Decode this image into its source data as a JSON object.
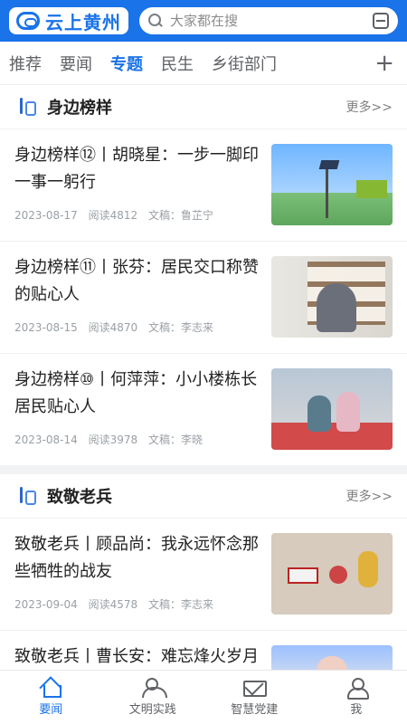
{
  "header": {
    "logo_text": "云上黄州",
    "search_placeholder": "大家都在搜"
  },
  "tabs": [
    {
      "label": "推荐"
    },
    {
      "label": "要闻"
    },
    {
      "label": "专题"
    },
    {
      "label": "民生"
    },
    {
      "label": "乡街部门"
    }
  ],
  "tabs_plus": "+",
  "sections": [
    {
      "title": "身边榜样",
      "more": "更多>>",
      "items": [
        {
          "title": "身边榜样⑫丨胡晓星：一步一脚印 一事一躬行",
          "date": "2023-08-17",
          "reads": "阅读4812",
          "author": "文稿：鲁芷宁"
        },
        {
          "title": "身边榜样⑪丨张芬：居民交口称赞的贴心人",
          "date": "2023-08-15",
          "reads": "阅读4870",
          "author": "文稿：李志来"
        },
        {
          "title": "身边榜样⑩丨何萍萍：小小楼栋长 居民贴心人",
          "date": "2023-08-14",
          "reads": "阅读3978",
          "author": "文稿：李晓"
        }
      ]
    },
    {
      "title": "致敬老兵",
      "more": "更多>>",
      "items": [
        {
          "title": "致敬老兵丨顾品尚：我永远怀念那些牺牲的战友",
          "date": "2023-09-04",
          "reads": "阅读4578",
          "author": "文稿：李志来"
        },
        {
          "title": "致敬老兵丨曹长安：难忘烽火岁月 永葆革命本色",
          "date": "",
          "reads": "",
          "author": ""
        }
      ]
    }
  ],
  "bottom_nav": [
    {
      "label": "要闻",
      "icon": "home-icon"
    },
    {
      "label": "文明实践",
      "icon": "people-icon"
    },
    {
      "label": "智慧党建",
      "icon": "mail-icon"
    },
    {
      "label": "我",
      "icon": "user-icon"
    }
  ],
  "colors": {
    "brand": "#1a73e8",
    "text": "#222222",
    "muted": "#9aa0a6",
    "background": "#f2f3f5"
  }
}
